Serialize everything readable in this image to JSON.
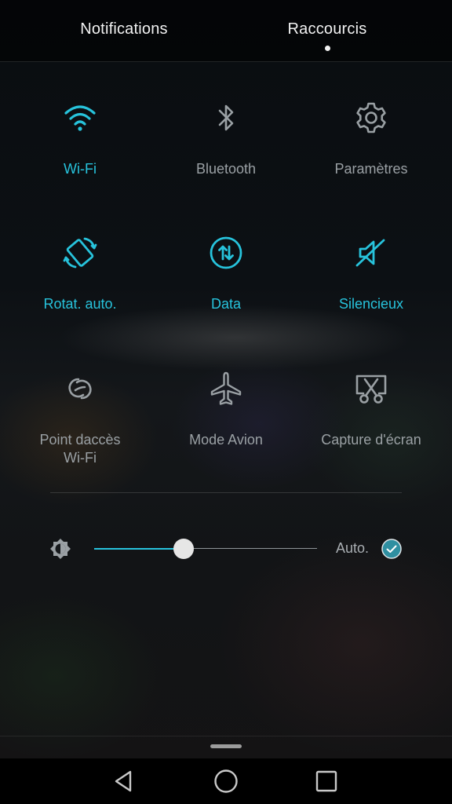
{
  "tabs": {
    "notifications": "Notifications",
    "shortcuts": "Raccourcis",
    "selected": "shortcuts"
  },
  "tiles": [
    {
      "label": "Wi-Fi",
      "icon": "wifi-icon",
      "active": true
    },
    {
      "label": "Bluetooth",
      "icon": "bluetooth-icon",
      "active": false
    },
    {
      "label": "Paramètres",
      "icon": "gear-icon",
      "active": false
    },
    {
      "label": "Rotat. auto.",
      "icon": "auto-rotate-icon",
      "active": true
    },
    {
      "label": "Data",
      "icon": "data-arrows-icon",
      "active": true
    },
    {
      "label": "Silencieux",
      "icon": "speaker-muted-icon",
      "active": true
    },
    {
      "label": "Point daccès Wi-Fi",
      "line1": "Point daccès",
      "line2": "Wi-Fi",
      "icon": "hotspot-icon",
      "active": false
    },
    {
      "label": "Mode Avion",
      "icon": "airplane-icon",
      "active": false
    },
    {
      "label": "Capture d'écran",
      "icon": "screenshot-icon",
      "active": false
    }
  ],
  "brightness": {
    "icon": "brightness-icon",
    "level": 0.4,
    "auto_label": "Auto.",
    "auto_checked": true
  },
  "navigation": {
    "back": "back-icon",
    "home": "home-icon",
    "recent": "recent-apps-icon"
  },
  "colors": {
    "accent": "#27c3dc",
    "inactive": "#9aa0a4",
    "text": "#f2f2f2"
  }
}
